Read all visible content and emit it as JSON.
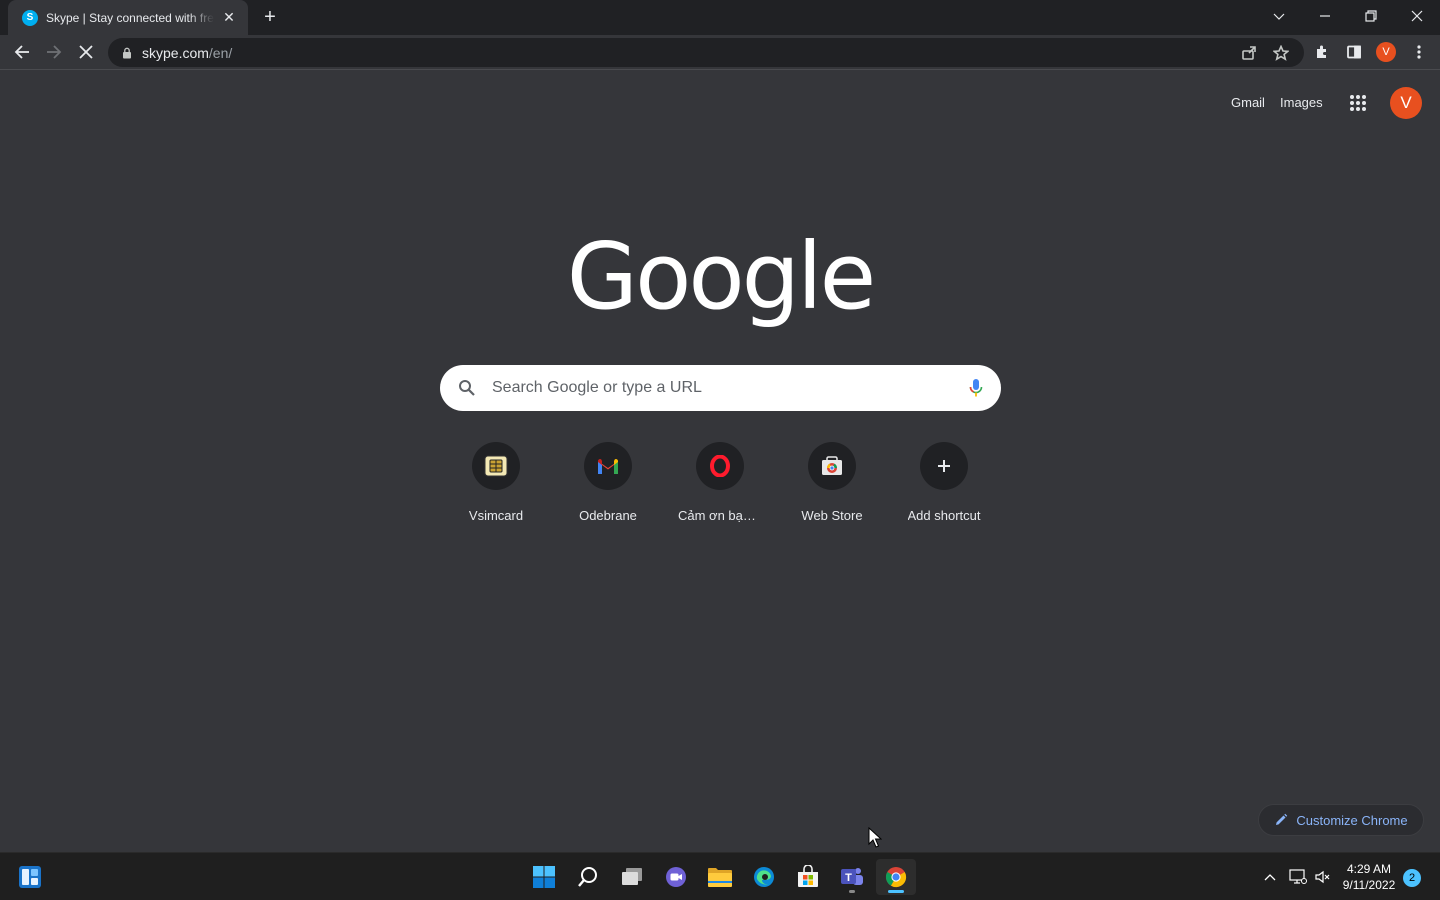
{
  "browser": {
    "tab": {
      "favicon": "S",
      "title": "Skype | Stay connected with free video calls worldwide",
      "close_label": "✕"
    },
    "new_tab_label": "+",
    "omnibox": {
      "host": "skype.com",
      "path": "/en/"
    },
    "profile_initial": "V"
  },
  "ntp": {
    "links": {
      "gmail": "Gmail",
      "images": "Images"
    },
    "account_initial": "V",
    "logo": "Google",
    "search": {
      "placeholder": "Search Google or type a URL"
    },
    "shortcuts": [
      {
        "label": "Vsimcard",
        "icon": "simcard-icon"
      },
      {
        "label": "Odebrane",
        "icon": "gmail-icon"
      },
      {
        "label": "Cảm ơn bạn đã tải xuống Opera",
        "icon": "opera-icon"
      },
      {
        "label": "Web Store",
        "icon": "webstore-icon"
      },
      {
        "label": "Add shortcut",
        "icon": "plus-icon"
      }
    ],
    "customize_label": "Customize Chrome"
  },
  "taskbar": {
    "time": "4:29 AM",
    "date": "9/11/2022",
    "notification_count": "2"
  },
  "colors": {
    "page_bg": "#35363a",
    "tabstrip_bg": "#202124",
    "accent_blue": "#8ab4f8",
    "avatar": "#e8501f",
    "taskbar_accent": "#4cc2ff"
  }
}
